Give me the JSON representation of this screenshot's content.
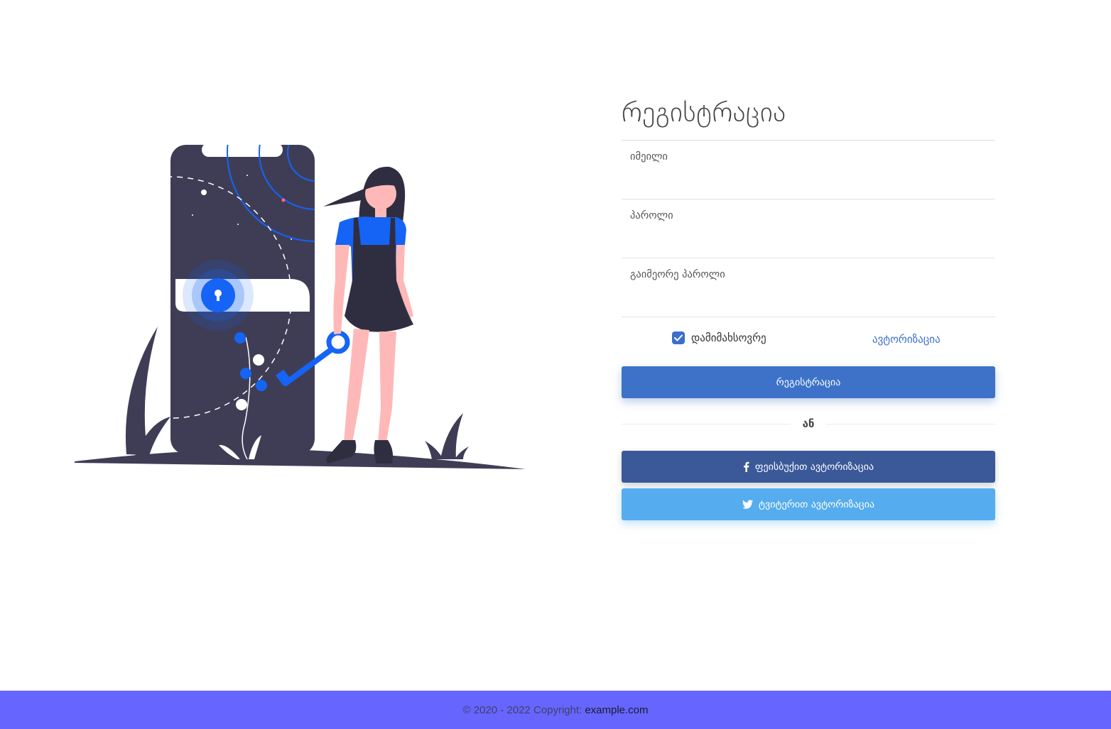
{
  "illustration": {
    "name": "security-login-illustration",
    "colors": {
      "dark": "#3f3d56",
      "accent": "#1564f5",
      "skin": "#ffb8b8",
      "shirt": "#1564f5"
    }
  },
  "form": {
    "title": "რეგისტრაცია",
    "email_placeholder": "იმეილი",
    "password_placeholder": "პაროლი",
    "confirm_password_placeholder": "გაიმეორე პაროლი",
    "remember_label": "დამიმახსოვრე",
    "remember_checked": true,
    "login_link": "ავტორიზაცია",
    "register_button": "რეგისტრაცია",
    "or_text": "ან",
    "facebook_button": "ფეისბუქით ავტორიზაცია",
    "twitter_button": "ტვიტერით ავტორიზაცია",
    "icons": {
      "facebook": "facebook-icon",
      "twitter": "twitter-icon",
      "check": "check-icon"
    }
  },
  "footer": {
    "copyright": "© 2020 - 2022 Copyright:",
    "site": "example.com"
  },
  "colors": {
    "primary": "#3d72c8",
    "facebook": "#3b5998",
    "twitter": "#55acee",
    "footer_bg": "#6666ff",
    "link": "#3b6fcb"
  }
}
